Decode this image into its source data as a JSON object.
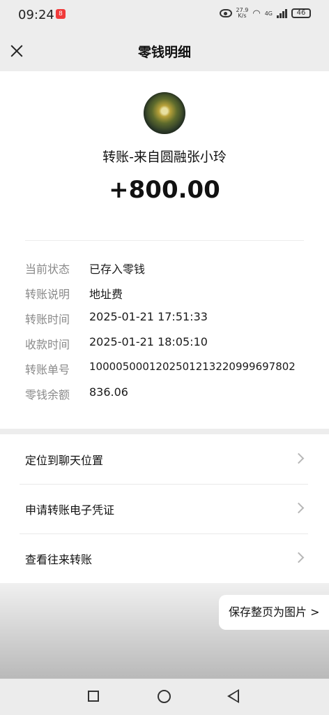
{
  "status_bar": {
    "time": "09:24",
    "app_badge": "8",
    "net_speed": "27.9",
    "net_speed_unit": "K/s",
    "network_type": "4G",
    "battery": "46"
  },
  "header": {
    "title": "零钱明细"
  },
  "transfer": {
    "payer": "转账-来自圆融张小玲",
    "amount": "+800.00"
  },
  "details": [
    {
      "label": "当前状态",
      "value": "已存入零钱"
    },
    {
      "label": "转账说明",
      "value": "地址费"
    },
    {
      "label": "转账时间",
      "value": "2025-01-21 17:51:33"
    },
    {
      "label": "收款时间",
      "value": "2025-01-21 18:05:10"
    },
    {
      "label": "转账单号",
      "value": "1000050001202501213220999697802"
    },
    {
      "label": "零钱余额",
      "value": "836.06"
    }
  ],
  "menu": [
    {
      "label": "定位到聊天位置"
    },
    {
      "label": "申请转账电子凭证"
    },
    {
      "label": "查看往来转账"
    }
  ],
  "save_button": {
    "label": "保存整页为图片 >"
  }
}
